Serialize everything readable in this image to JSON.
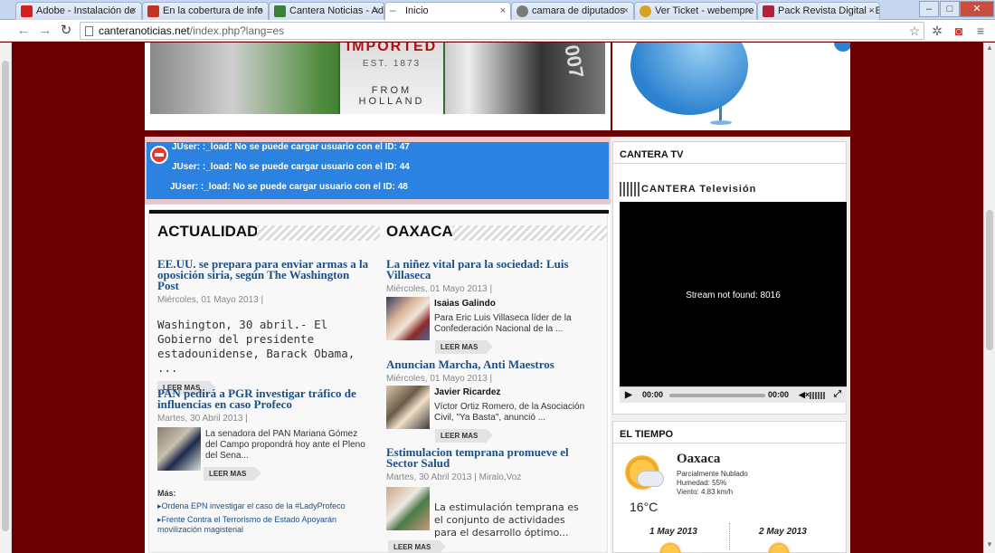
{
  "browser": {
    "tabs": [
      {
        "title": "Adobe - Instalación de",
        "fav": "#d21f1f"
      },
      {
        "title": "En la cobertura de info",
        "fav": "#c23321"
      },
      {
        "title": "Cantera Noticias - Adm",
        "fav": "#3a7f3a"
      },
      {
        "title": "Inicio",
        "fav": "#2e7d4f"
      },
      {
        "title": "camara de diputados",
        "fav": "#7a7a7a"
      },
      {
        "title": "Ver Ticket - webempre",
        "fav": "#d8a21f"
      },
      {
        "title": "Pack Revista Digital - E",
        "fav": "#b0223a"
      }
    ],
    "active_tab": 3,
    "url_host": "canteranoticias.net",
    "url_path": "/index.php?lang=es"
  },
  "banner": {
    "label_top": "IMPORTED",
    "label_mid": "EST. 1873",
    "label_bottom": "FROM HOLLAND",
    "bottle_number": "007"
  },
  "errors": [
    "JUser: :_load: No se puede cargar usuario con el ID: 47",
    "JUser: :_load: No se puede cargar usuario con el ID: 44",
    "JUser: :_load: No se puede cargar usuario con el ID: 48"
  ],
  "actualidad": {
    "heading": "ACTUALIDAD",
    "lead": {
      "title": "EE.UU. se prepara para enviar armas a la oposición siria, según The Washington Post",
      "meta": "Miércoles, 01 Mayo 2013  |",
      "summary": "Washington, 30 abril.- El Gobierno del presidente estadounidense, Barack Obama, ..."
    },
    "second": {
      "title": "PAN pedirá a PGR investigar tráfico de influencias en caso Profeco",
      "meta": "Martes, 30 Abril 2013  |",
      "summary": "La senadora del PAN Mariana Gómez del Campo propondrá hoy ante el Pleno del Sena..."
    },
    "more_label": "Más:",
    "more_links": [
      "Ordena EPN investigar el caso de la #LadyProfeco",
      "Frente Contra el Terrorismo de Estado Apoyarán movilización magisterial"
    ]
  },
  "oaxaca": {
    "heading": "OAXACA",
    "articles": [
      {
        "title": "La niñez vital para la sociedad: Luis Villaseca",
        "meta": "Miércoles, 01 Mayo 2013  |",
        "author": "Isaias Galindo",
        "summary": "Para Eric Luis Villaseca líder de la Confederación Nacional de la ..."
      },
      {
        "title": "Anuncian Marcha, Anti Maestros",
        "meta": "Miércoles, 01 Mayo 2013  |",
        "author": "Javier Ricardez",
        "summary": "Víctor Ortiz Romero, de la Asociación Civil, \"Ya Basta\", anunció ..."
      },
      {
        "title": "Estimulacion temprana promueve el Sector Salud",
        "meta": "Martes, 30 Abril 2013  |  Miralo,Voz",
        "author": "",
        "summary": "La estimulación temprana es el conjunto de actividades para el desarrollo óptimo..."
      }
    ]
  },
  "read_more": "LEER MAS",
  "cantera_tv": {
    "heading": "CANTERA TV",
    "logo_text": "CANTERA Televisión",
    "stream_msg": "Stream not found: 8016",
    "time_current": "00:00",
    "time_total": "00:00"
  },
  "weather": {
    "heading": "EL TIEMPO",
    "city": "Oaxaca",
    "condition": "Parcialmente Nublado",
    "humidity": "Humedad: 55%",
    "wind": "Viento: 4.83 km/h",
    "temp": "16°C",
    "day1": "1 May 2013",
    "day2": "2 May 2013"
  },
  "colors": {
    "accent_blue": "#1a4f8a",
    "site_bg": "#6b0000",
    "error_blue": "#2b82e0"
  }
}
